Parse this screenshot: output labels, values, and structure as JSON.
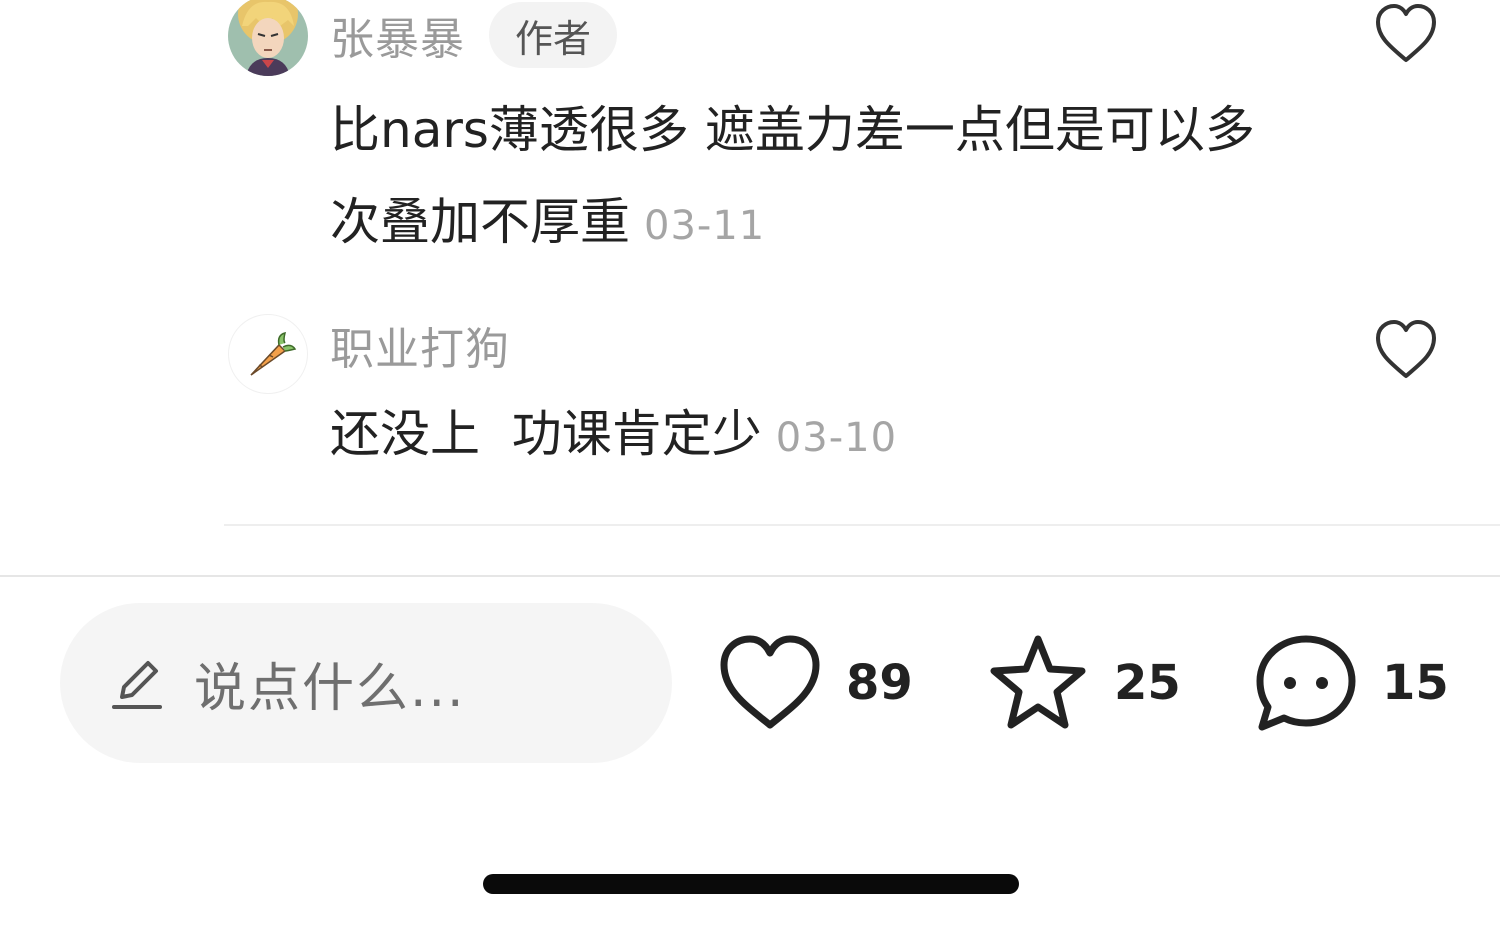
{
  "comments": [
    {
      "username": "张暴暴",
      "badge": "作者",
      "text": "比nars薄透很多 遮盖力差一点但是可以多次叠加不厚重",
      "date": "03-11"
    },
    {
      "username": "职业打狗",
      "text": "还没上  功课肯定少",
      "date": "03-10"
    }
  ],
  "input": {
    "placeholder": "说点什么..."
  },
  "actions": {
    "like_count": "89",
    "collect_count": "25",
    "comment_count": "15"
  },
  "icons": {
    "pencil": "pencil-icon",
    "heart": "heart-icon",
    "star": "star-icon",
    "chat": "chat-bubble-icon",
    "carrot": "carrot-icon"
  }
}
